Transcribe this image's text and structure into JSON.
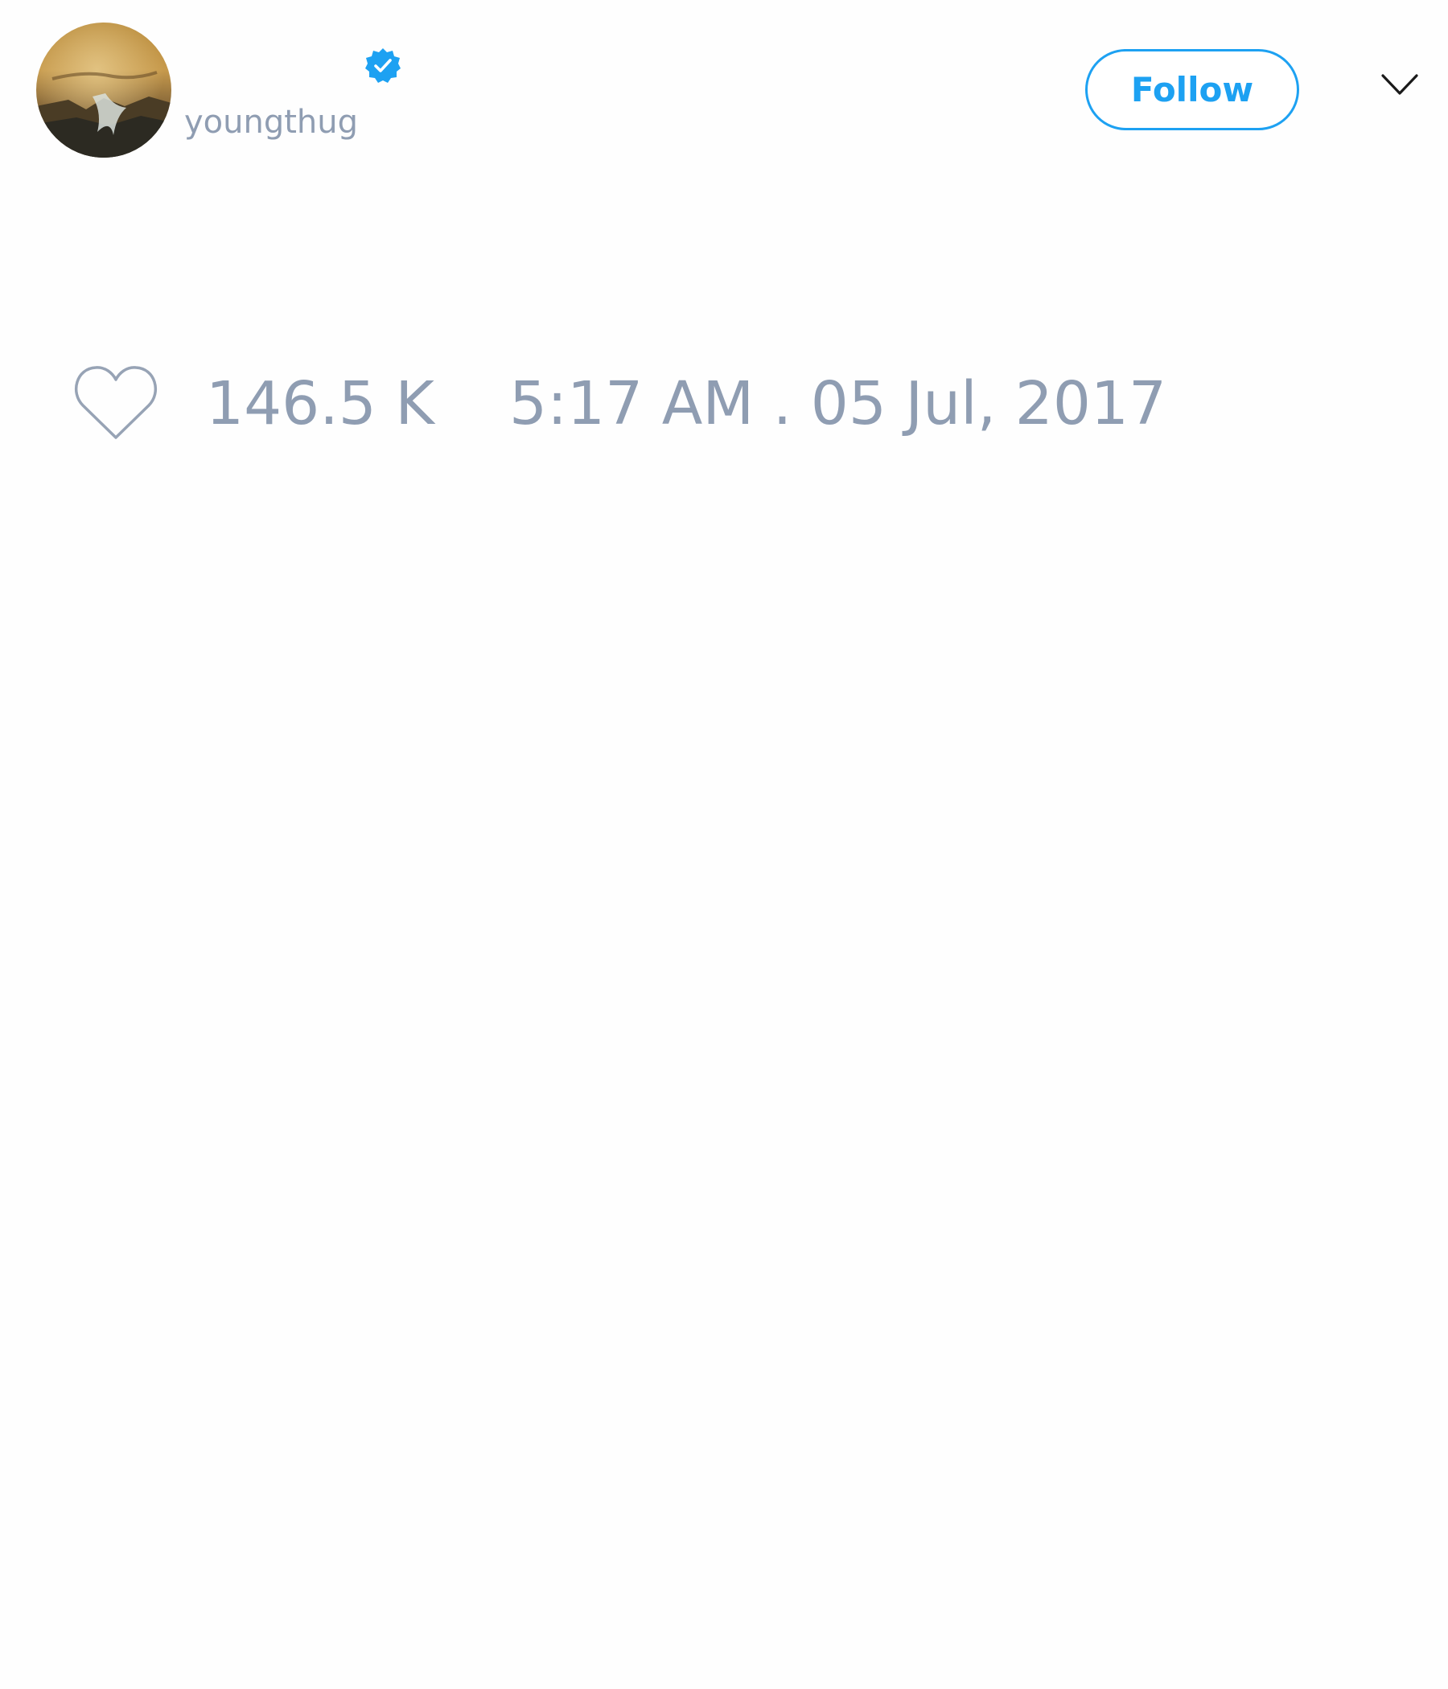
{
  "tweet": {
    "author": {
      "handle": "youngthug",
      "verified": true,
      "avatar_icon": "profile-photo-landscape"
    },
    "follow_label": "Follow",
    "menu_icon": "chevron-down-icon",
    "likes": {
      "icon": "heart-outline-icon",
      "count": "146.5 K"
    },
    "timestamp": "5:17 AM . 05 Jul, 2017"
  },
  "colors": {
    "accent": "#1da1f2",
    "muted_text": "#8f9db2",
    "background": "#fefefe",
    "icon_stroke": "#97a3b5"
  }
}
